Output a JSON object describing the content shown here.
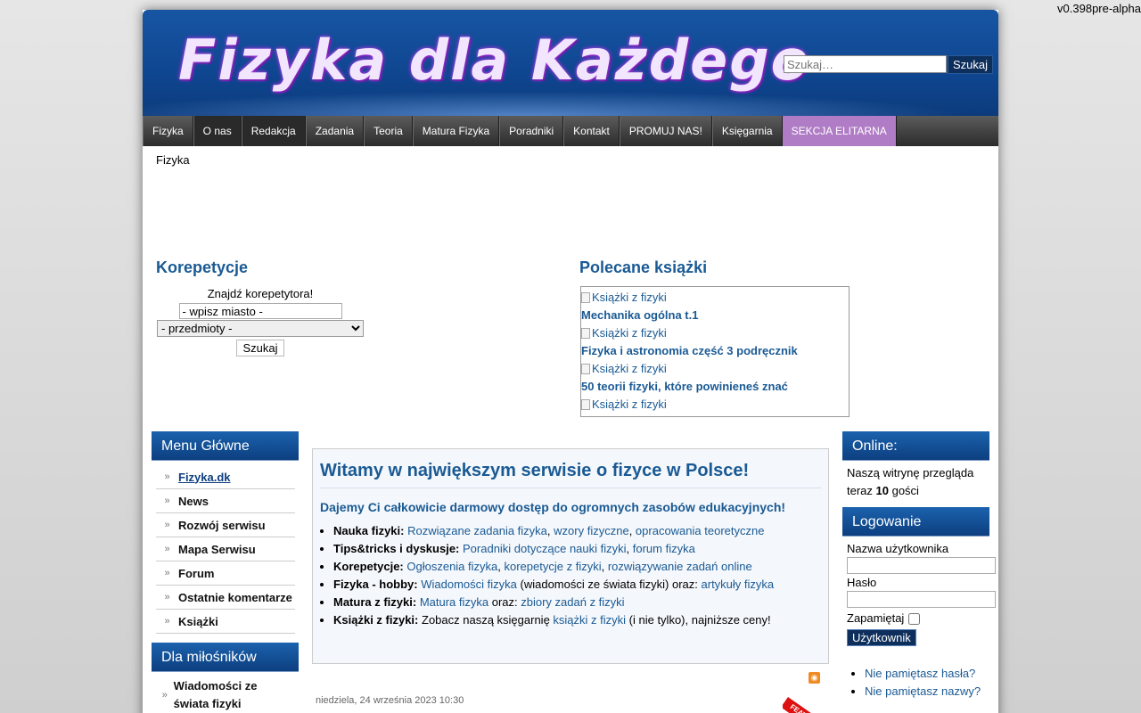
{
  "version": "v0.398pre-alpha",
  "header": {
    "logo_text": "Fizyka dla Każdego",
    "search_placeholder": "Szukaj…",
    "search_button": "Szukaj"
  },
  "nav": [
    "Fizyka",
    "O nas",
    "Redakcja",
    "Zadania",
    "Teoria",
    "Matura Fizyka",
    "Poradniki",
    "Kontakt",
    "PROMUJ NAS!",
    "Księgarnia",
    "SEKCJA ELITARNA"
  ],
  "breadcrumb": "Fizyka",
  "korepetycje": {
    "title": "Korepetycje",
    "find": "Znajdź korepetytora!",
    "city_placeholder": "- wpisz miasto -",
    "subjects": "- przedmioty -",
    "button": "Szukaj"
  },
  "books": {
    "title": "Polecane książki",
    "alt": "Książki z fizyki",
    "items": [
      "Mechanika ogólna t.1",
      "Fizyka i astronomia część 3 podręcznik",
      "50 teorii fizyki, które powinieneś znać"
    ]
  },
  "main_menu": {
    "title": "Menu Główne",
    "items": [
      "Fizyka.dk",
      "News",
      "Rozwój serwisu",
      "Mapa Serwisu",
      "Forum",
      "Ostatnie komentarze",
      "Książki"
    ]
  },
  "fans_menu": {
    "title": "Dla miłośników",
    "items": [
      "Wiadomości ze świata fizyki"
    ]
  },
  "intro": {
    "title": "Witamy w największym serwisie o fizyce w Polsce!",
    "subtitle": "Dajemy Ci całkowicie darmowy dostęp do ogromnych zasobów edukacyjnych!",
    "rows": [
      {
        "label": "Nauka fizyki:",
        "parts": [
          {
            "l": "Rozwiązane zadania fizyka"
          },
          {
            "t": ", "
          },
          {
            "l": "wzory fizyczne"
          },
          {
            "t": ", "
          },
          {
            "l": "opracowania teoretyczne"
          }
        ]
      },
      {
        "label": "Tips&tricks i dyskusje:",
        "parts": [
          {
            "l": "Poradniki dotyczące nauki fizyki"
          },
          {
            "t": ", "
          },
          {
            "l": "forum fizyka"
          }
        ]
      },
      {
        "label": "Korepetycje:",
        "parts": [
          {
            "l": "Ogłoszenia fizyka"
          },
          {
            "t": ", "
          },
          {
            "l": "korepetycje z fizyki"
          },
          {
            "t": ", "
          },
          {
            "l": "rozwiązywanie zadań online"
          }
        ]
      },
      {
        "label": "Fizyka - hobby:",
        "parts": [
          {
            "l": "Wiadomości fizyka"
          },
          {
            "t": " (wiadomości ze świata fizyki) oraz: "
          },
          {
            "l": "artykuły fizyka"
          }
        ]
      },
      {
        "label": "Matura z fizyki:",
        "parts": [
          {
            "l": "Matura fizyka"
          },
          {
            "t": " oraz: "
          },
          {
            "l": "zbiory zadań z fizyki"
          }
        ]
      },
      {
        "label": "Książki z fizyki:",
        "parts": [
          {
            "t": "Zobacz naszą księgarnię "
          },
          {
            "l": "książki z fizyki"
          },
          {
            "t": " (i nie tylko), najniższe ceny!"
          }
        ]
      }
    ]
  },
  "article": {
    "date": "niedziela, 24 września 2023 10:30",
    "featured": "FEATURED"
  },
  "online": {
    "title": "Online:",
    "text1": "Naszą witrynę przegląda teraz ",
    "count": "10",
    "text2": " gości"
  },
  "login": {
    "title": "Logowanie",
    "user_label": "Nazwa użytkownika",
    "pass_label": "Hasło",
    "remember": "Zapamiętaj",
    "button": "Użytkownik",
    "links": [
      "Nie pamiętasz hasła?",
      "Nie pamiętasz nazwy?"
    ]
  }
}
